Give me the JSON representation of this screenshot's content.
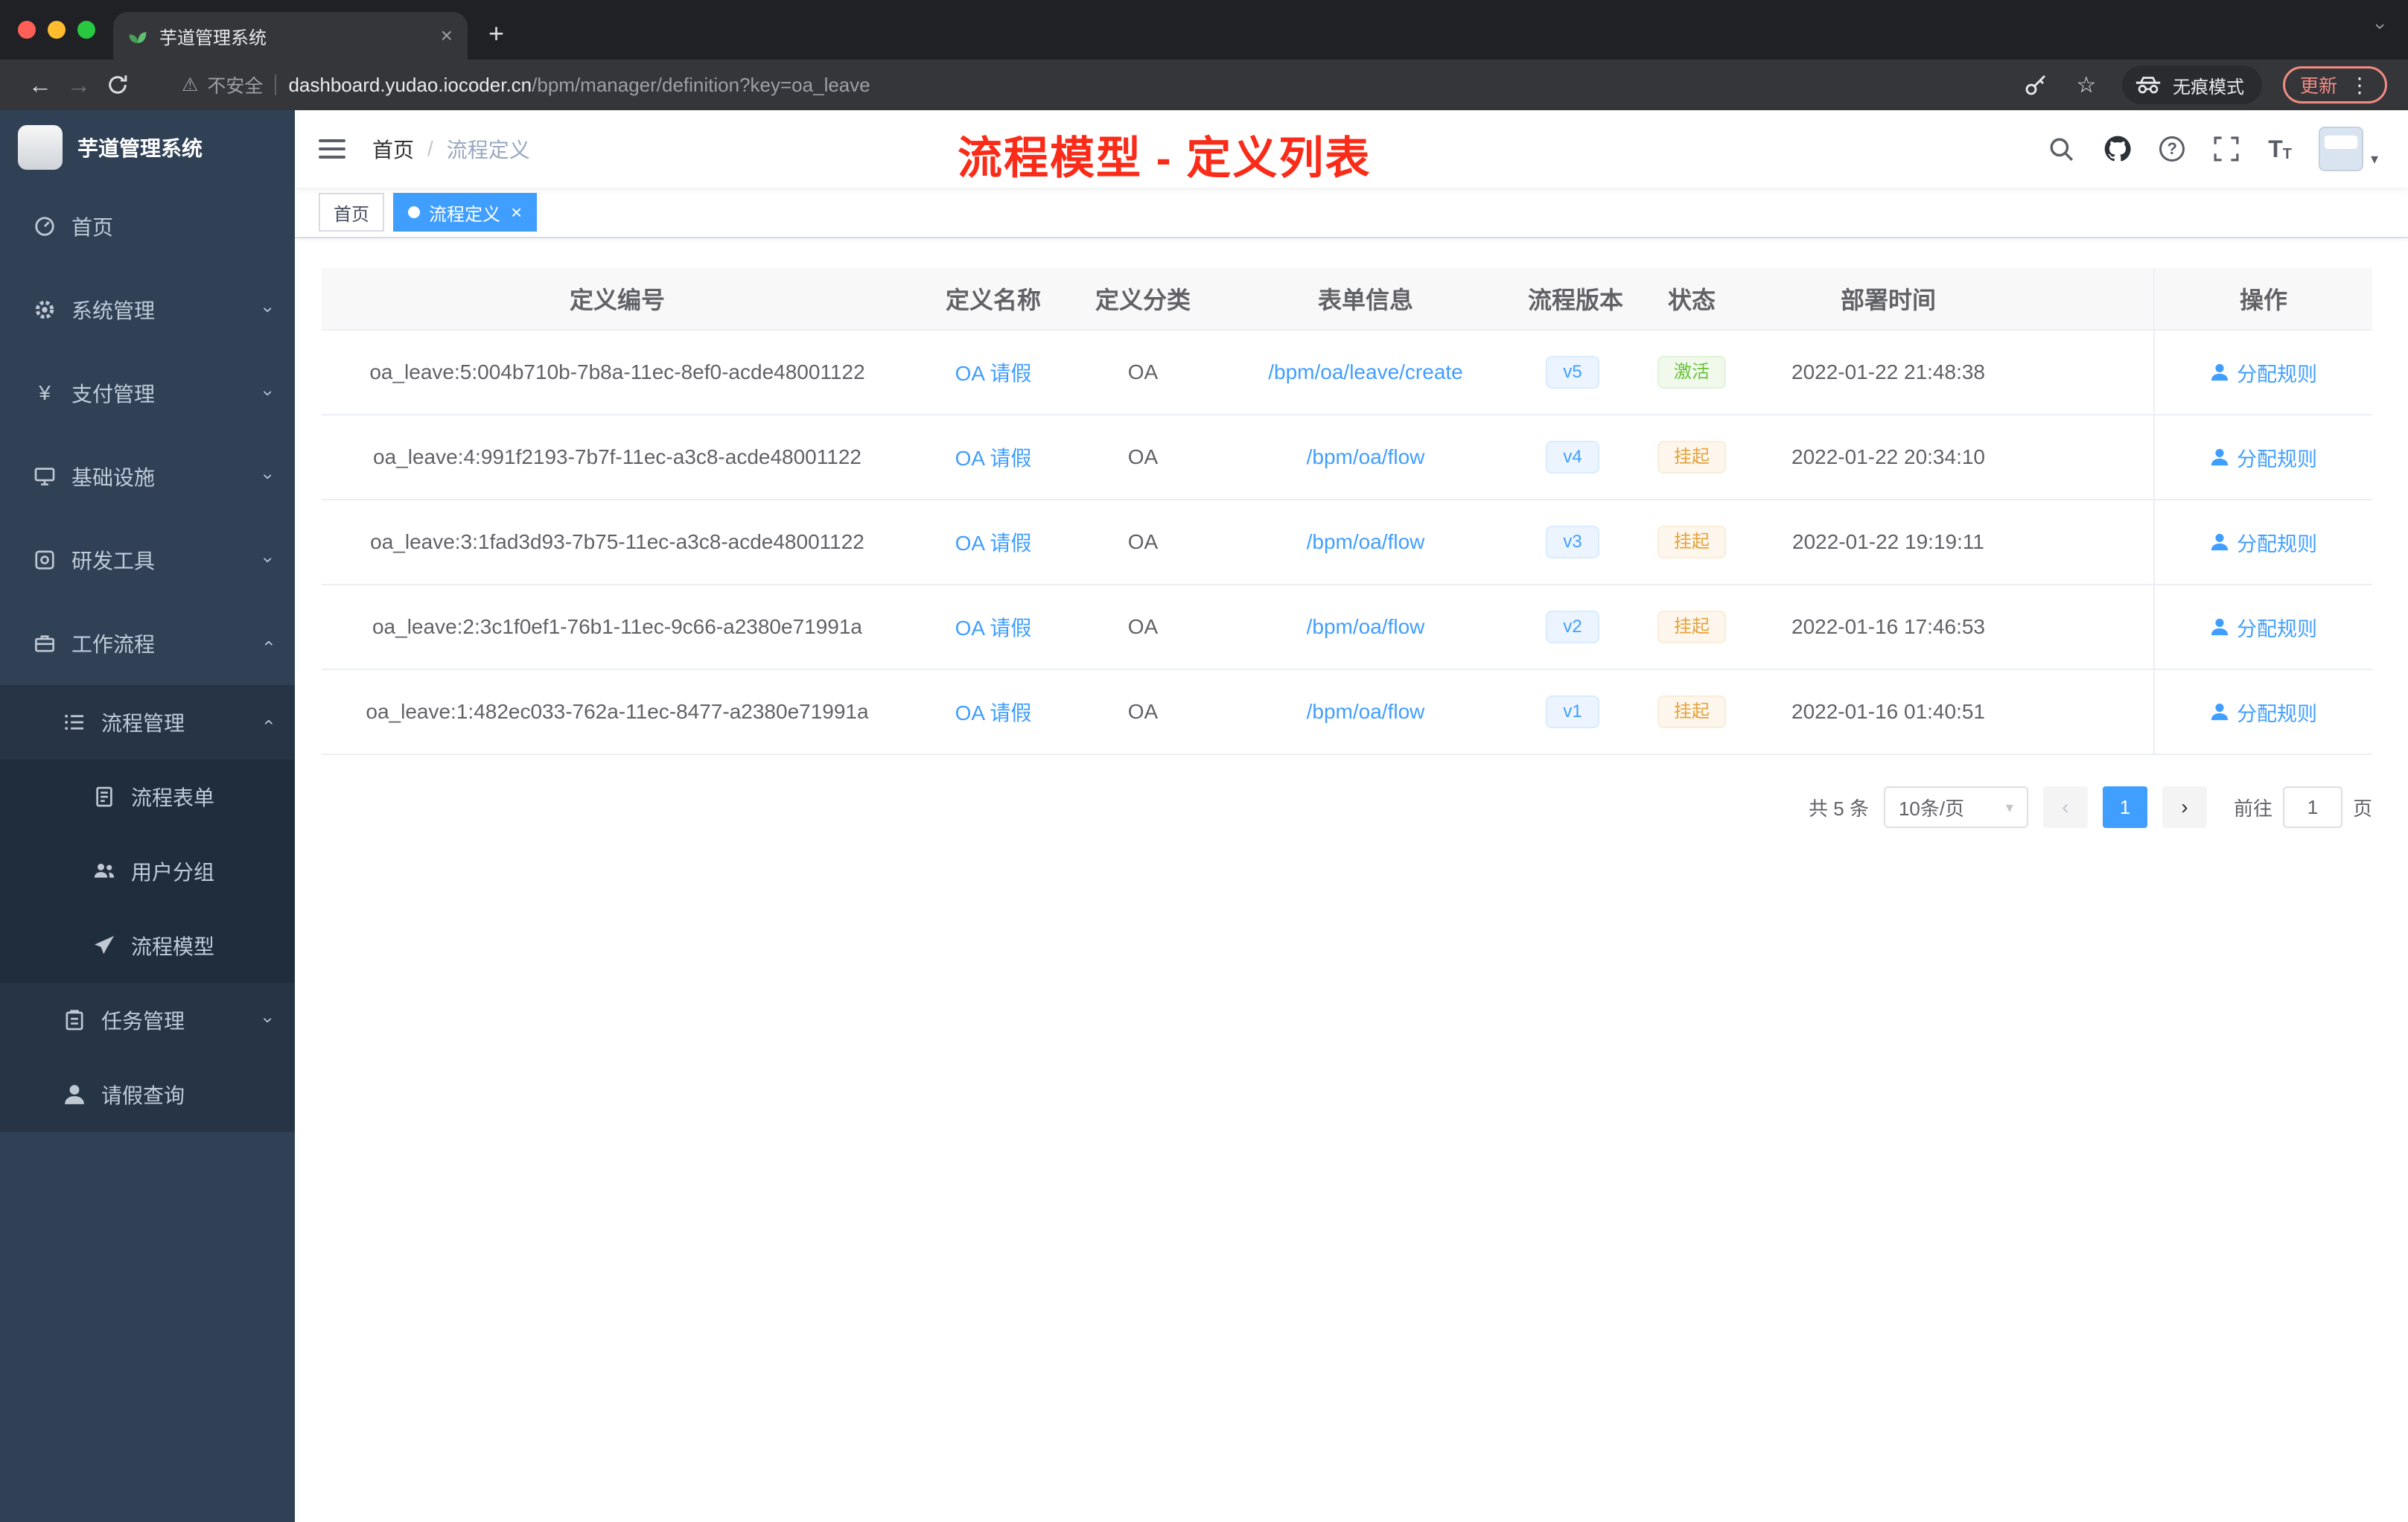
{
  "browser": {
    "tab_title": "芋道管理系统",
    "security_label": "不安全",
    "url_domain": "dashboard.yudao.iocoder.cn",
    "url_path": "/bpm/manager/definition?key=oa_leave",
    "incognito_label": "无痕模式",
    "update_label": "更新"
  },
  "sidebar": {
    "logo_title": "芋道管理系统",
    "items": [
      {
        "label": "首页",
        "icon": "dashboard-icon"
      },
      {
        "label": "系统管理",
        "icon": "gear-icon",
        "expand": "down"
      },
      {
        "label": "支付管理",
        "icon": "yen-icon",
        "expand": "down"
      },
      {
        "label": "基础设施",
        "icon": "infrastructure-icon",
        "expand": "down"
      },
      {
        "label": "研发工具",
        "icon": "dev-tools-icon",
        "expand": "down"
      },
      {
        "label": "工作流程",
        "icon": "briefcase-icon",
        "expand": "up"
      },
      {
        "label": "流程管理",
        "icon": "list-icon",
        "expand": "up"
      },
      {
        "label": "流程表单",
        "icon": "form-icon"
      },
      {
        "label": "用户分组",
        "icon": "user-group-icon"
      },
      {
        "label": "流程模型",
        "icon": "send-icon"
      },
      {
        "label": "任务管理",
        "icon": "task-icon",
        "expand": "down"
      },
      {
        "label": "请假查询",
        "icon": "user-icon"
      }
    ]
  },
  "header": {
    "breadcrumb": [
      "首页",
      "流程定义"
    ],
    "annotation": "流程模型 - 定义列表"
  },
  "tags": [
    {
      "label": "首页",
      "active": false
    },
    {
      "label": "流程定义",
      "active": true
    }
  ],
  "table": {
    "columns": [
      "定义编号",
      "定义名称",
      "定义分类",
      "表单信息",
      "流程版本",
      "状态",
      "部署时间",
      "操作"
    ],
    "rows": [
      {
        "id": "oa_leave:5:004b710b-7b8a-11ec-8ef0-acde48001122",
        "name": "OA 请假",
        "category": "OA",
        "form": "/bpm/oa/leave/create",
        "version": "v5",
        "status": "激活",
        "status_type": "success",
        "time": "2022-01-22 21:48:38",
        "action": "分配规则"
      },
      {
        "id": "oa_leave:4:991f2193-7b7f-11ec-a3c8-acde48001122",
        "name": "OA 请假",
        "category": "OA",
        "form": "/bpm/oa/flow",
        "version": "v4",
        "status": "挂起",
        "status_type": "warning",
        "time": "2022-01-22 20:34:10",
        "action": "分配规则"
      },
      {
        "id": "oa_leave:3:1fad3d93-7b75-11ec-a3c8-acde48001122",
        "name": "OA 请假",
        "category": "OA",
        "form": "/bpm/oa/flow",
        "version": "v3",
        "status": "挂起",
        "status_type": "warning",
        "time": "2022-01-22 19:19:11",
        "action": "分配规则"
      },
      {
        "id": "oa_leave:2:3c1f0ef1-76b1-11ec-9c66-a2380e71991a",
        "name": "OA 请假",
        "category": "OA",
        "form": "/bpm/oa/flow",
        "version": "v2",
        "status": "挂起",
        "status_type": "warning",
        "time": "2022-01-16 17:46:53",
        "action": "分配规则"
      },
      {
        "id": "oa_leave:1:482ec033-762a-11ec-8477-a2380e71991a",
        "name": "OA 请假",
        "category": "OA",
        "form": "/bpm/oa/flow",
        "version": "v1",
        "status": "挂起",
        "status_type": "warning",
        "time": "2022-01-16 01:40:51",
        "action": "分配规则"
      }
    ]
  },
  "pagination": {
    "total": "共 5 条",
    "page_size": "10条/页",
    "current_page": "1",
    "goto_label": "前往",
    "goto_value": "1",
    "unit_label": "页"
  },
  "icons": {
    "close": "×",
    "plus": "+",
    "back": "←",
    "forward": "→",
    "warning": "⚠",
    "star": "☆",
    "more_vert": "⋮",
    "caret_down": "▾",
    "chevron_right": "›",
    "chevron_left": "‹",
    "question": "?",
    "yen": "¥",
    "breadcrumb_sep": "/",
    "font_large": "T",
    "font_small": "T"
  },
  "colors": {
    "accent": "#409eff",
    "success": "#67c23a",
    "warning": "#e6a23c",
    "annotation_red": "#fa2c19",
    "sidebar_bg": "#304156",
    "tab_bg": "#35363a"
  }
}
